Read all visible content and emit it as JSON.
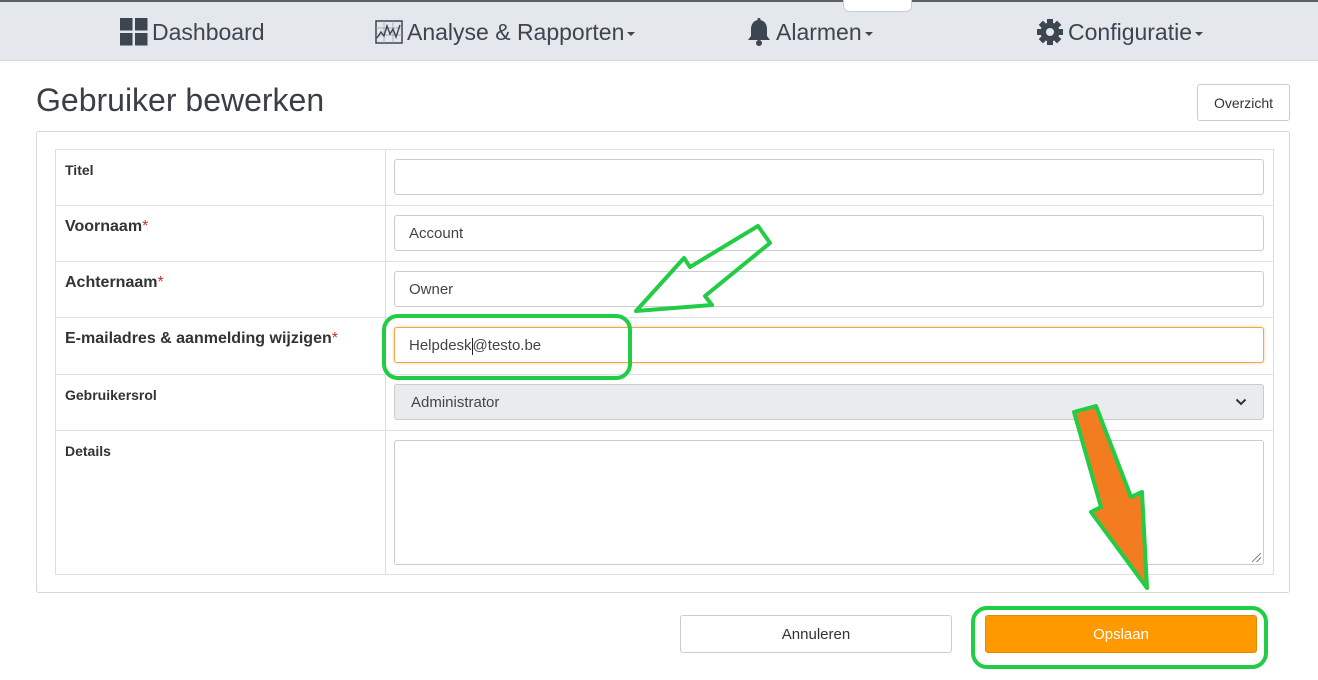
{
  "nav": {
    "items": [
      {
        "label": "Dashboard",
        "icon": "dashboard-grid-icon"
      },
      {
        "label": "Analyse & Rapporten",
        "icon": "chart-icon"
      },
      {
        "label": "Alarmen",
        "icon": "bell-icon"
      },
      {
        "label": "Configuratie",
        "icon": "gear-icon"
      }
    ]
  },
  "page": {
    "title": "Gebruiker bewerken",
    "overview_button": "Overzicht"
  },
  "form": {
    "required_mark": "*",
    "fields": [
      {
        "label": "Titel",
        "value": "",
        "required": false
      },
      {
        "label": "Voornaam",
        "value": "Account",
        "required": true
      },
      {
        "label": "Achternaam",
        "value": "Owner",
        "required": true
      },
      {
        "label": "E-mailadres & aanmelding wijzigen",
        "value_before_cursor": "Helpdesk",
        "value_after_cursor": "@testo.be",
        "required": true
      },
      {
        "label": "Gebruikersrol",
        "value": "Administrator",
        "required": false
      },
      {
        "label": "Details",
        "value": "",
        "required": false
      }
    ]
  },
  "actions": {
    "cancel": "Annuleren",
    "save": "Opslaan"
  },
  "colors": {
    "accent": "#ff9900",
    "annotation_green": "#22cc44",
    "annotation_orange": "#f47c20"
  }
}
